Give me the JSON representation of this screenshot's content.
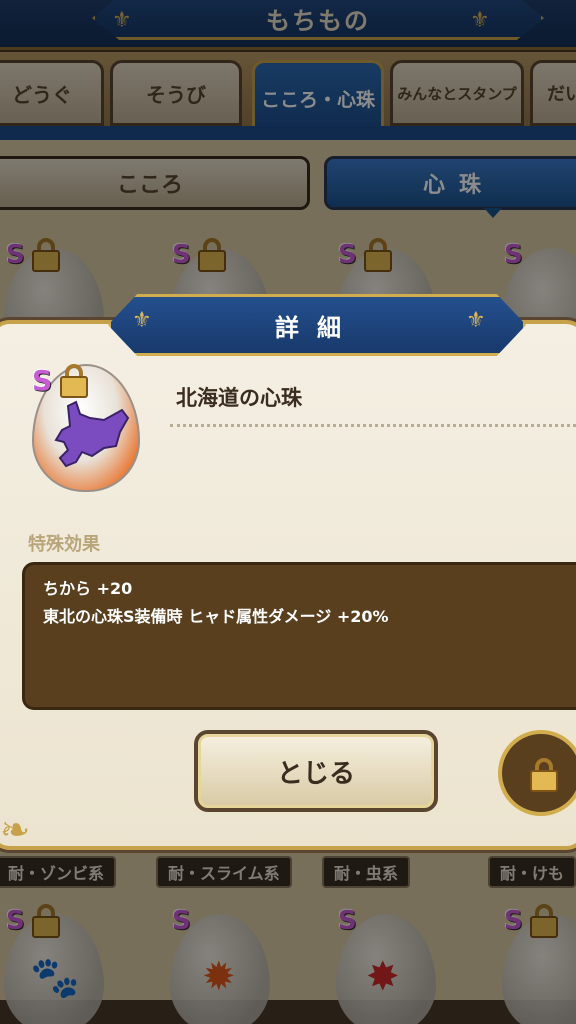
{
  "header": {
    "title": "もちもの"
  },
  "tabs": [
    {
      "label": "どうぐ"
    },
    {
      "label": "そうび"
    },
    {
      "label": "こころ・心珠",
      "active": true
    },
    {
      "label": "みんなとスタンプ"
    },
    {
      "label": "だい"
    }
  ],
  "subtabs": [
    {
      "label": "こころ"
    },
    {
      "label": "心珠",
      "active": true
    }
  ],
  "grid_badge": "S",
  "traits": [
    {
      "label": "耐・ゾンビ系"
    },
    {
      "label": "耐・スライム系"
    },
    {
      "label": "耐・虫系"
    },
    {
      "label": "耐・けも"
    }
  ],
  "modal": {
    "title": "詳細",
    "item_name": "北海道の心珠",
    "badge": "S",
    "effect_label": "特殊効果",
    "effects": [
      "ちから +20",
      "東北の心珠S装備時 ヒャド属性ダメージ +20%"
    ],
    "close_label": "とじる"
  },
  "colors": {
    "accent_gold": "#c8a24a",
    "header_blue": "#1f3e6b",
    "effect_bg": "#5a3f1e"
  }
}
